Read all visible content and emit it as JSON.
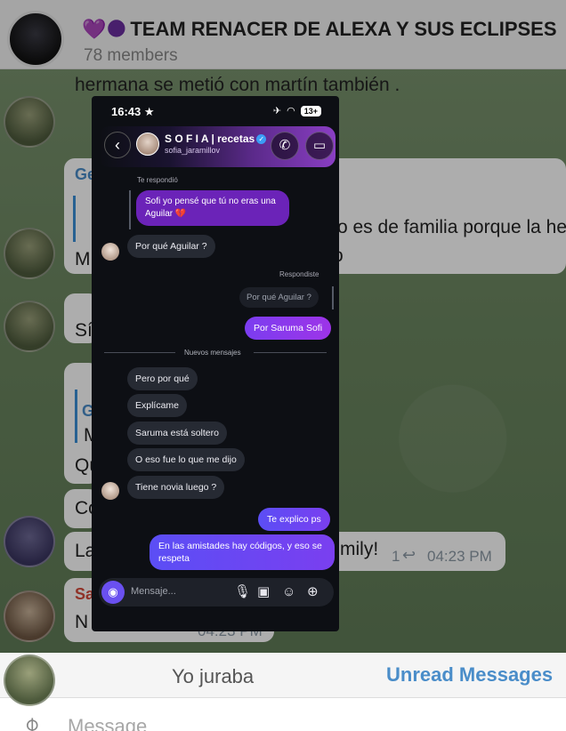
{
  "telegram": {
    "group_title": "TEAM RENACER DE ALEXA Y SUS ECLIPSES",
    "title_emoji": "💜🌑",
    "members": "78 members",
    "messages": [
      {
        "text": "hermana se metió con martín también ."
      },
      {
        "name": "Ge",
        "text": "ro es de familia porque la he",
        "prefix": "M",
        "suffix": "o"
      },
      {
        "text": "Sí"
      },
      {
        "name": "G",
        "quote": "M",
        "text": "Qu"
      },
      {
        "text": "Co"
      },
      {
        "text": "La",
        "suffix": "mily!",
        "meta": "1",
        "time": "04:23 PM"
      },
      {
        "name": "Sa",
        "text": "N",
        "time": "04:23 PM"
      }
    ],
    "unread_left": "Yo juraba",
    "unread_right": "Unread Messages",
    "input_placeholder": "Message",
    "colors": {
      "link": "#4a8dc9",
      "sender_red": "#d54a3b"
    }
  },
  "instagram": {
    "status": {
      "time": "16:43 ★",
      "airplane": "✈",
      "wifi": "◠",
      "badge": "13+"
    },
    "header": {
      "name": "S O F I A | recetas",
      "username": "sofia_jaramillov",
      "back_icon": "chevron-left-icon",
      "call_icon": "phone-icon",
      "video_icon": "video-icon"
    },
    "reply_label": "Te respondió",
    "quoted_message": "Sofi yo pensé que tú no eras una Aguilar 💔",
    "msg_por_que_aguilar": "Por qué Aguilar ?",
    "responded_label": "Respondiste",
    "quoted_mine": "Por qué Aguilar ?",
    "my_reply": "Por Saruma Sofi",
    "new_messages": "Nuevos mensajes",
    "incoming": [
      "Pero por qué",
      "Explícame",
      "Saruma está soltero",
      "O eso fue lo que me dijo",
      "Tiene novia luego ?"
    ],
    "outgoing": [
      "Te explico ps",
      "En las amistades hay códigos, y eso se respeta"
    ],
    "composer": {
      "placeholder": "Mensaje...",
      "mic": "🎙",
      "gallery": "▣",
      "sticker": "☺",
      "add": "⊕",
      "camera": "📷"
    },
    "colors": {
      "purple_bubble": "#6b23b8",
      "mine_gradient_start": "#7b3df0",
      "incoming_bg": "#262a33",
      "verified": "#3b9cf5"
    }
  }
}
